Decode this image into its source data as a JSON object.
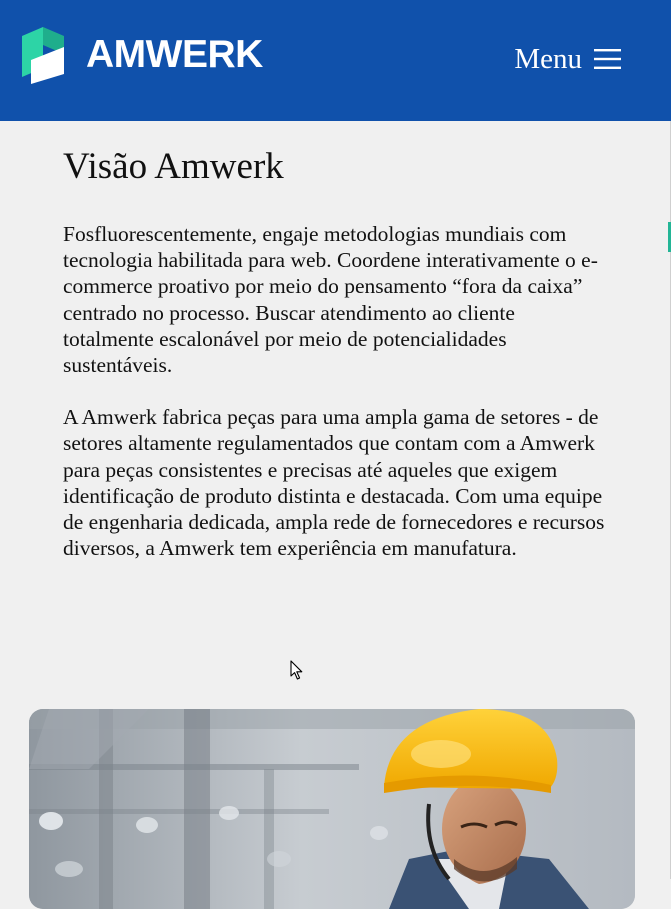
{
  "header": {
    "logo_text": "AMWERK",
    "menu_label": "Menu",
    "brand_color": "#1051ab",
    "logo_accent_color": "#23c29b"
  },
  "main": {
    "title": "Visão Amwerk",
    "paragraphs": [
      "Fosfluorescentemente, engaje metodologias mundiais com tecnologia habilitada para web. Coordene interativamente o e-commerce proativo por meio do pensamento “fora da caixa” centrado no processo. Buscar atendimento ao cliente totalmente escalonável por meio de potencialidades sustentáveis.",
      "A Amwerk fabrica peças para uma ampla gama de setores - de setores altamente regulamentados que contam com a Amwerk para peças consistentes e precisas até aqueles que exigem identificação de produto distinta e destacada. Com uma equipe de engenharia dedicada, ampla rede de fornecedores e recursos diversos, a Amwerk tem experiência em manufatura."
    ]
  },
  "icons": {
    "menu": "hamburger-icon",
    "cursor": "mouse-pointer-icon"
  }
}
